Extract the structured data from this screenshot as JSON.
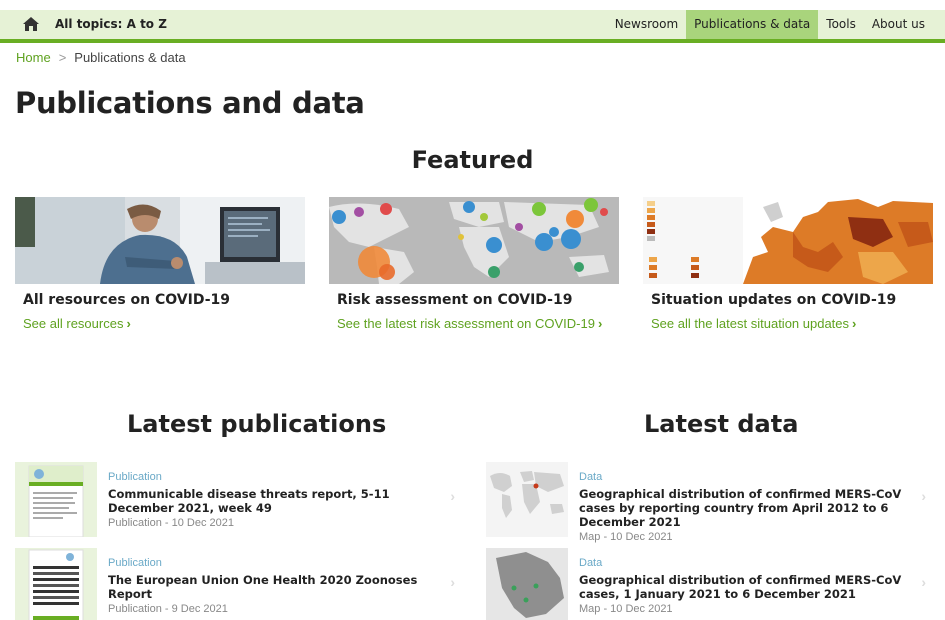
{
  "header": {
    "home_label": "Home",
    "topics": "All topics: A to Z",
    "nav": [
      "Newsroom",
      "Publications & data",
      "Tools",
      "About us"
    ],
    "active_nav": "Publications & data"
  },
  "breadcrumb": {
    "home": "Home",
    "separator": ">",
    "current": "Publications & data"
  },
  "page_title": "Publications and data",
  "featured": {
    "heading": "Featured",
    "cards": [
      {
        "title": "All resources on COVID-19",
        "link": "See all resources"
      },
      {
        "title": "Risk assessment on COVID-19",
        "link": "See the latest risk assessment on COVID-19"
      },
      {
        "title": "Situation updates on COVID-19",
        "link": "See all the latest situation updates"
      }
    ]
  },
  "latest_publications": {
    "heading": "Latest publications",
    "items": [
      {
        "type": "Publication",
        "title": "Communicable disease threats report, 5-11 December 2021, week 49",
        "meta": "Publication - 10 Dec 2021"
      },
      {
        "type": "Publication",
        "title": "The European Union One Health 2020 Zoonoses Report",
        "meta": "Publication - 9 Dec 2021"
      }
    ]
  },
  "latest_data": {
    "heading": "Latest data",
    "items": [
      {
        "type": "Data",
        "title": "Geographical distribution of confirmed MERS-CoV cases by reporting country from April 2012 to 6 December 2021",
        "meta": "Map - 10 Dec 2021"
      },
      {
        "type": "Data",
        "title": "Geographical distribution of confirmed MERS-CoV cases, 1 January 2021 to 6 December 2021",
        "meta": "Map - 10 Dec 2021"
      }
    ]
  },
  "colors": {
    "brand_green": "#69ae23",
    "link_green": "#5fa220",
    "nav_bg": "#e6f2d6",
    "active_nav_bg": "#a9d47c",
    "type_blue": "#6aa9c7"
  },
  "icons": {
    "home": "home-icon",
    "chevron": "chevron-right-icon"
  }
}
